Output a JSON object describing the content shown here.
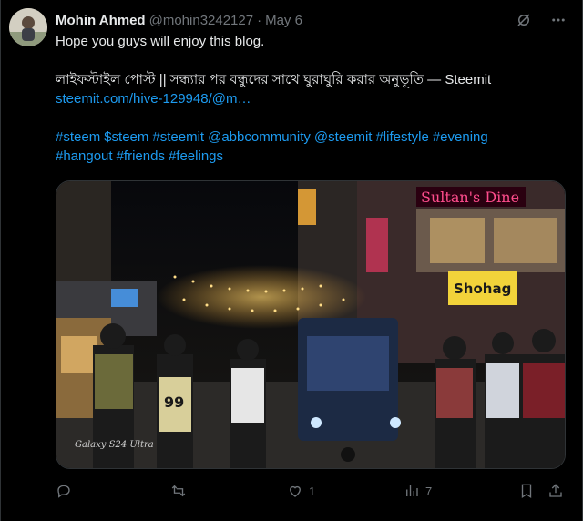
{
  "tweet": {
    "author_name": "Mohin Ahmed",
    "author_handle": "@mohin3242127",
    "separator": "·",
    "date": "May 6",
    "line1": "Hope you guys will enjoy this blog.",
    "line2": "লাইফস্টাইল পোস্ট || সন্ধ্যার পর বন্ধুদের সাথে ঘুরাঘুরি করার অনুভূতি — Steemit",
    "link": "steemit.com/hive-129948/@m…",
    "hashtags_line1": [
      "#steem",
      "$steem",
      "#steemit",
      "@abbcommunity",
      "@steemit",
      "#lifestyle",
      "#evening"
    ],
    "hashtags_line2": [
      "#hangout",
      "#friends",
      "#feelings"
    ]
  },
  "media": {
    "sign_1": "Sultan's Dine",
    "sign_2": "Shohag",
    "jersey_number": "99",
    "watermark": "Galaxy S24 Ultra"
  },
  "actions": {
    "reply_count": "",
    "retweet_count": "",
    "like_count": "1",
    "views_count": "7"
  },
  "icons": {
    "header": [
      "no-grok-icon",
      "more-icon"
    ],
    "actions": [
      "reply-icon",
      "retweet-icon",
      "like-icon",
      "views-icon",
      "bookmark-icon",
      "share-icon"
    ]
  },
  "colors": {
    "background": "#000000",
    "text": "#e7e9ea",
    "muted": "#71767b",
    "link": "#1d9bf0"
  }
}
